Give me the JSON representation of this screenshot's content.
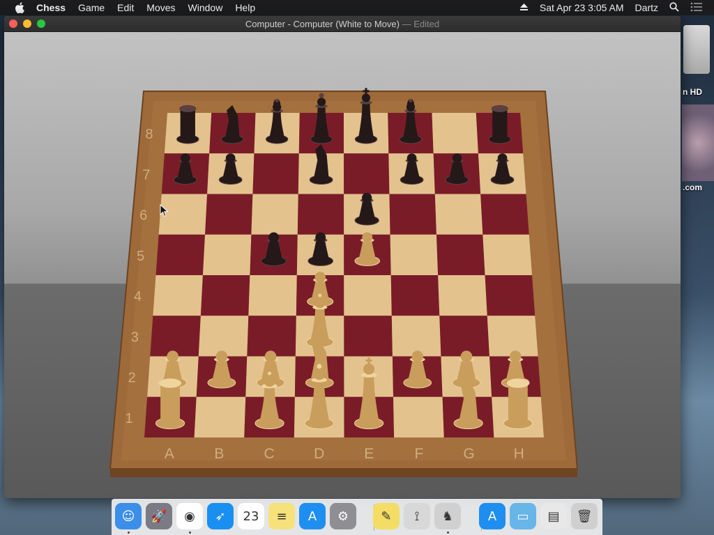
{
  "menubar": {
    "app_name": "Chess",
    "menus": [
      "Game",
      "Edit",
      "Moves",
      "Window",
      "Help"
    ],
    "clock": "Sat Apr 23  3:05 AM",
    "user": "Dartz"
  },
  "desktop": {
    "hd_label": "n HD",
    "com_label": ".com"
  },
  "window": {
    "title": "Computer - Computer   (White to Move)",
    "edited": "— Edited"
  },
  "board": {
    "files": [
      "A",
      "B",
      "C",
      "D",
      "E",
      "F",
      "G",
      "H"
    ],
    "ranks": [
      "8",
      "7",
      "6",
      "5",
      "4",
      "3",
      "2",
      "1"
    ],
    "pieces": [
      {
        "square": "a8",
        "color": "black",
        "type": "rook"
      },
      {
        "square": "b8",
        "color": "black",
        "type": "knight"
      },
      {
        "square": "c8",
        "color": "black",
        "type": "bishop"
      },
      {
        "square": "d8",
        "color": "black",
        "type": "queen"
      },
      {
        "square": "e8",
        "color": "black",
        "type": "king"
      },
      {
        "square": "f8",
        "color": "black",
        "type": "bishop"
      },
      {
        "square": "h8",
        "color": "black",
        "type": "rook"
      },
      {
        "square": "a7",
        "color": "black",
        "type": "pawn"
      },
      {
        "square": "b7",
        "color": "black",
        "type": "pawn"
      },
      {
        "square": "d7",
        "color": "black",
        "type": "knight"
      },
      {
        "square": "f7",
        "color": "black",
        "type": "pawn"
      },
      {
        "square": "g7",
        "color": "black",
        "type": "pawn"
      },
      {
        "square": "h7",
        "color": "black",
        "type": "pawn"
      },
      {
        "square": "e6",
        "color": "black",
        "type": "pawn"
      },
      {
        "square": "c5",
        "color": "black",
        "type": "pawn"
      },
      {
        "square": "d5",
        "color": "black",
        "type": "pawn"
      },
      {
        "square": "e5",
        "color": "white",
        "type": "pawn"
      },
      {
        "square": "d4",
        "color": "white",
        "type": "pawn"
      },
      {
        "square": "d3",
        "color": "white",
        "type": "bishop"
      },
      {
        "square": "a2",
        "color": "white",
        "type": "pawn"
      },
      {
        "square": "b2",
        "color": "white",
        "type": "pawn"
      },
      {
        "square": "c2",
        "color": "white",
        "type": "pawn"
      },
      {
        "square": "d2",
        "color": "white",
        "type": "knight"
      },
      {
        "square": "f2",
        "color": "white",
        "type": "pawn"
      },
      {
        "square": "g2",
        "color": "white",
        "type": "pawn"
      },
      {
        "square": "h2",
        "color": "white",
        "type": "pawn"
      },
      {
        "square": "a1",
        "color": "white",
        "type": "rook"
      },
      {
        "square": "c1",
        "color": "white",
        "type": "bishop"
      },
      {
        "square": "d1",
        "color": "white",
        "type": "queen"
      },
      {
        "square": "e1",
        "color": "white",
        "type": "king"
      },
      {
        "square": "g1",
        "color": "white",
        "type": "knight"
      },
      {
        "square": "h1",
        "color": "white",
        "type": "rook"
      }
    ]
  },
  "colors": {
    "light_square": "#e3c28e",
    "dark_square": "#7a1c28",
    "frame": "#9e6a3a",
    "black_piece": "#241818",
    "white_piece": "#c99d5c"
  },
  "dock": {
    "items": [
      {
        "name": "finder-icon",
        "label": "Finder",
        "color": "#3b8fe8",
        "glyph": "☺",
        "running": true
      },
      {
        "name": "launchpad-icon",
        "label": "Launchpad",
        "color": "#7b7b86",
        "glyph": "🚀",
        "running": false
      },
      {
        "name": "chrome-icon",
        "label": "Chrome",
        "color": "#ffffff",
        "glyph": "◉",
        "running": true
      },
      {
        "name": "safari-icon",
        "label": "Safari",
        "color": "#1a8ff2",
        "glyph": "➶",
        "running": false
      },
      {
        "name": "calendar-icon",
        "label": "23",
        "color": "#ffffff",
        "glyph": "23",
        "running": false
      },
      {
        "name": "notes-icon",
        "label": "Notes",
        "color": "#f7e17a",
        "glyph": "≡",
        "running": false
      },
      {
        "name": "app-store-icon",
        "label": "App Store",
        "color": "#1f8ef1",
        "glyph": "A",
        "running": false
      },
      {
        "name": "system-preferences-icon",
        "label": "System Preferences",
        "color": "#8e8e93",
        "glyph": "⚙",
        "running": false
      },
      {
        "name": "stickies-icon",
        "label": "Stickies",
        "color": "#f4dd65",
        "glyph": "✎",
        "running": false
      },
      {
        "name": "instruments-icon",
        "label": "Instruments",
        "color": "#d8d8d8",
        "glyph": "⟟",
        "running": false
      },
      {
        "name": "chess-icon",
        "label": "Chess",
        "color": "#d0d0d0",
        "glyph": "♞",
        "running": true
      },
      {
        "name": "app-store-downloads-icon",
        "label": "Downloads",
        "color": "#1f8ef1",
        "glyph": "A",
        "running": false
      },
      {
        "name": "folder-icon",
        "label": "Folder",
        "color": "#68b5e8",
        "glyph": "▭",
        "running": false
      },
      {
        "name": "documents-stack-icon",
        "label": "Documents",
        "color": "#e8e8e8",
        "glyph": "▤",
        "running": false
      },
      {
        "name": "trash-icon",
        "label": "Trash",
        "color": "#cfcfcf",
        "glyph": "🗑",
        "running": false
      }
    ]
  }
}
